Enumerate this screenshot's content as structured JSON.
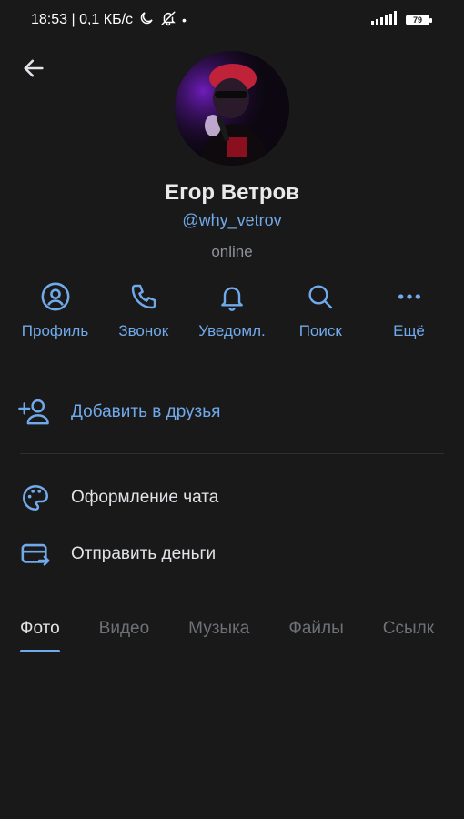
{
  "status_bar": {
    "time_speed": "18:53 | 0,1 КБ/с",
    "battery": "79",
    "icons": [
      "moon-icon",
      "bell-off-icon",
      "signal-icon",
      "battery-icon"
    ]
  },
  "header": {
    "back_icon": "arrow-left-icon"
  },
  "profile": {
    "name": "Егор Ветров",
    "username": "@why_vetrov",
    "status": "online"
  },
  "actions": [
    {
      "label": "Профиль",
      "icon": "user-circle-icon"
    },
    {
      "label": "Звонок",
      "icon": "phone-icon"
    },
    {
      "label": "Уведомл.",
      "icon": "bell-icon"
    },
    {
      "label": "Поиск",
      "icon": "search-icon"
    },
    {
      "label": "Ещё",
      "icon": "more-icon"
    }
  ],
  "add_friend": {
    "label": "Добавить в друзья",
    "icon": "add-user-icon"
  },
  "menu": [
    {
      "label": "Оформление чата",
      "icon": "palette-icon"
    },
    {
      "label": "Отправить деньги",
      "icon": "money-transfer-icon"
    }
  ],
  "tabs": [
    {
      "label": "Фото",
      "active": true
    },
    {
      "label": "Видео",
      "active": false
    },
    {
      "label": "Музыка",
      "active": false
    },
    {
      "label": "Файлы",
      "active": false
    },
    {
      "label": "Ссылк",
      "active": false
    }
  ],
  "colors": {
    "background": "#19191a",
    "accent": "#71aaeb",
    "text_primary": "#e1e3e6",
    "text_secondary": "#8f9399"
  }
}
